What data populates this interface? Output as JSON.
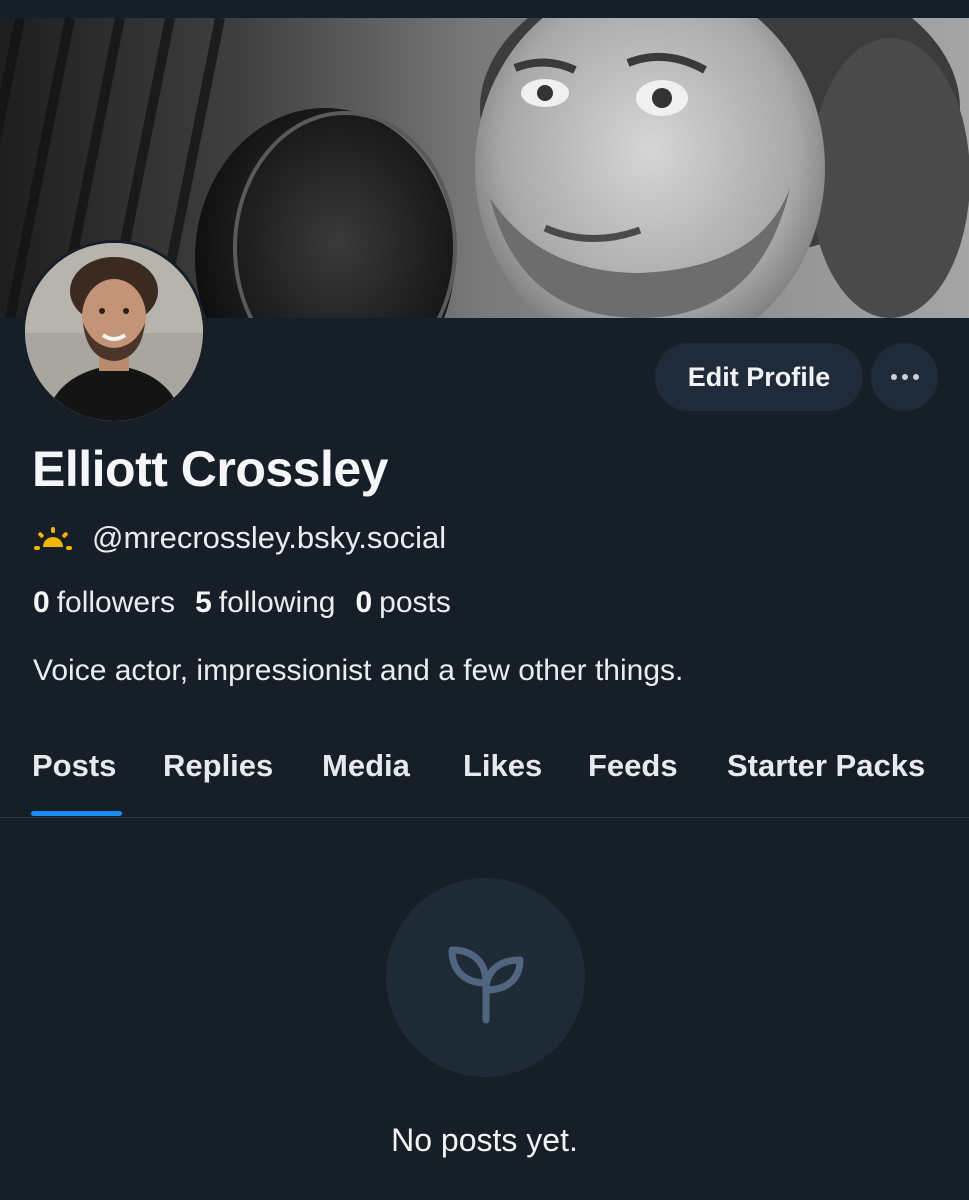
{
  "profile": {
    "display_name": "Elliott Crossley",
    "handle": "@mrecrossley.bsky.social",
    "bio": "Voice actor, impressionist and a few other things."
  },
  "actions": {
    "edit_profile_label": "Edit Profile"
  },
  "stats": {
    "followers_count": "0",
    "followers_label": "followers",
    "following_count": "5",
    "following_label": "following",
    "posts_count": "0",
    "posts_label": "posts"
  },
  "tabs": [
    {
      "label": "Posts",
      "active": true
    },
    {
      "label": "Replies",
      "active": false
    },
    {
      "label": "Media",
      "active": false
    },
    {
      "label": "Likes",
      "active": false
    },
    {
      "label": "Feeds",
      "active": false
    },
    {
      "label": "Starter Packs",
      "active": false
    }
  ],
  "empty_state": {
    "message": "No posts yet.",
    "icon": "seedling-icon"
  },
  "icons": {
    "handle_badge": "sunrise-icon",
    "more_menu": "ellipsis-icon"
  },
  "colors": {
    "background": "#161e27",
    "button_bg": "#1f2b38",
    "accent": "#1d8cf8",
    "badge": "#f5b400",
    "icon_muted": "#4f6580"
  }
}
